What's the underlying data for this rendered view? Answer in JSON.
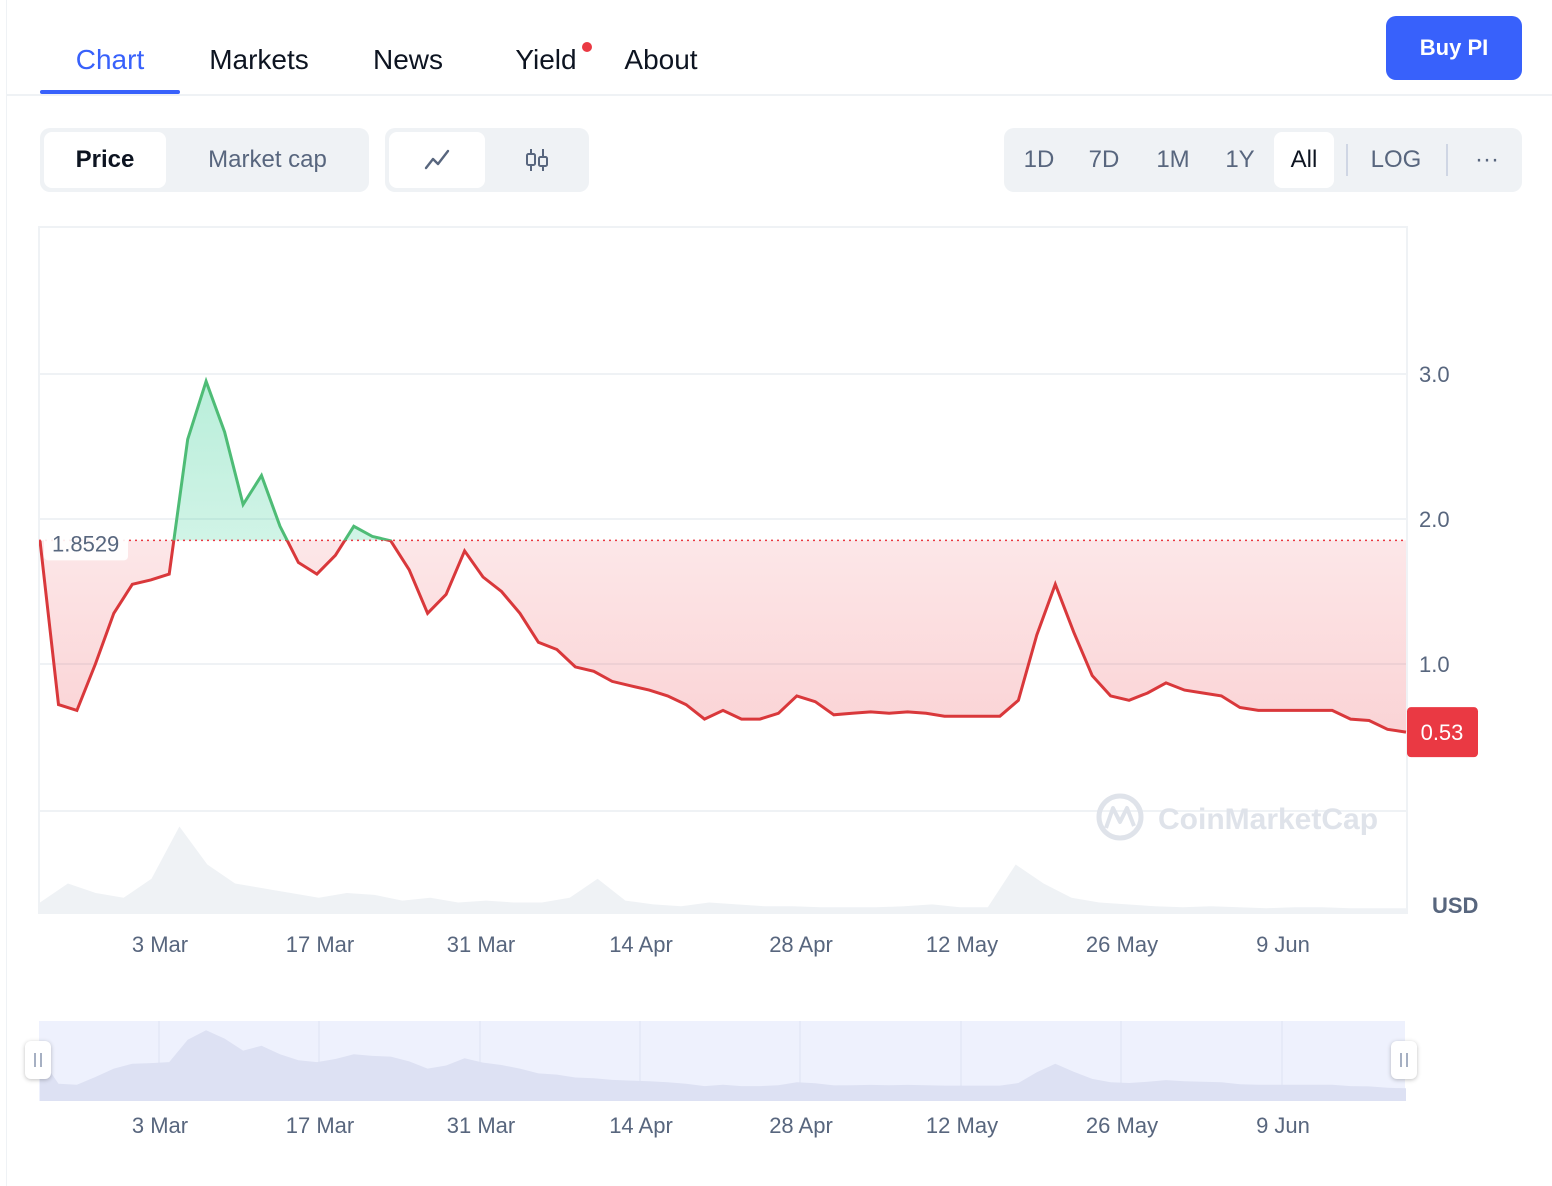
{
  "nav": {
    "tabs": [
      {
        "label": "Chart",
        "active": true
      },
      {
        "label": "Markets",
        "active": false
      },
      {
        "label": "News",
        "active": false
      },
      {
        "label": "Yield",
        "active": false,
        "notification_dot": true
      },
      {
        "label": "About",
        "active": false
      }
    ],
    "buy_button_label": "Buy PI"
  },
  "controls": {
    "metric_toggle": [
      {
        "label": "Price",
        "active": true
      },
      {
        "label": "Market cap",
        "active": false
      }
    ],
    "chart_style_toggle": [
      {
        "icon": "line-chart-icon",
        "active": true
      },
      {
        "icon": "candlestick-icon",
        "active": false
      }
    ],
    "ranges": [
      {
        "label": "1D",
        "active": false
      },
      {
        "label": "7D",
        "active": false
      },
      {
        "label": "1M",
        "active": false
      },
      {
        "label": "1Y",
        "active": false
      },
      {
        "label": "All",
        "active": true
      }
    ],
    "log_label": "LOG",
    "more_label": "···"
  },
  "colors": {
    "accent": "#3861fb",
    "up": "#16c784",
    "up_line": "#4ebc76",
    "down": "#ea3943",
    "down_line": "#d9383b",
    "grid": "#eff2f5",
    "muted_text": "#58667e"
  },
  "chart_data": {
    "type": "line",
    "y_axis_ticks": [
      "3.0",
      "2.0",
      "1.0"
    ],
    "ylim": [
      0.3,
      3.6
    ],
    "y_unit_label": "USD",
    "x_tick_labels": [
      "3 Mar",
      "17 Mar",
      "31 Mar",
      "14 Apr",
      "28 Apr",
      "12 May",
      "26 May",
      "9 Jun"
    ],
    "start_price_label": "1.8529",
    "start_price": 1.8529,
    "current_price_label": "0.53",
    "current_price": 0.53,
    "watermark": "CoinMarketCap",
    "series": [
      {
        "values": [
          1.85,
          0.72,
          0.68,
          1.0,
          1.35,
          1.55,
          1.58,
          1.62,
          2.55,
          2.95,
          2.6,
          2.1,
          2.3,
          1.95,
          1.7,
          1.62,
          1.75,
          1.95,
          1.88,
          1.85,
          1.65,
          1.35,
          1.48,
          1.78,
          1.6,
          1.5,
          1.35,
          1.15,
          1.1,
          0.98,
          0.95,
          0.88,
          0.85,
          0.82,
          0.78,
          0.72,
          0.62,
          0.68,
          0.62,
          0.62,
          0.66,
          0.78,
          0.74,
          0.65,
          0.66,
          0.67,
          0.66,
          0.67,
          0.66,
          0.64,
          0.64,
          0.64,
          0.64,
          0.75,
          1.2,
          1.55,
          1.22,
          0.92,
          0.78,
          0.75,
          0.8,
          0.87,
          0.82,
          0.8,
          0.78,
          0.7,
          0.68,
          0.68,
          0.68,
          0.68,
          0.68,
          0.62,
          0.61,
          0.55,
          0.53
        ]
      }
    ],
    "volume": [
      0.1,
      0.3,
      0.2,
      0.15,
      0.35,
      0.9,
      0.5,
      0.3,
      0.25,
      0.2,
      0.15,
      0.2,
      0.18,
      0.12,
      0.15,
      0.1,
      0.12,
      0.1,
      0.1,
      0.15,
      0.35,
      0.12,
      0.08,
      0.06,
      0.1,
      0.08,
      0.06,
      0.06,
      0.05,
      0.05,
      0.05,
      0.06,
      0.08,
      0.05,
      0.05,
      0.5,
      0.3,
      0.15,
      0.1,
      0.08,
      0.06,
      0.05,
      0.06,
      0.05,
      0.04,
      0.05,
      0.05,
      0.04,
      0.04,
      0.04
    ],
    "grid": true
  }
}
